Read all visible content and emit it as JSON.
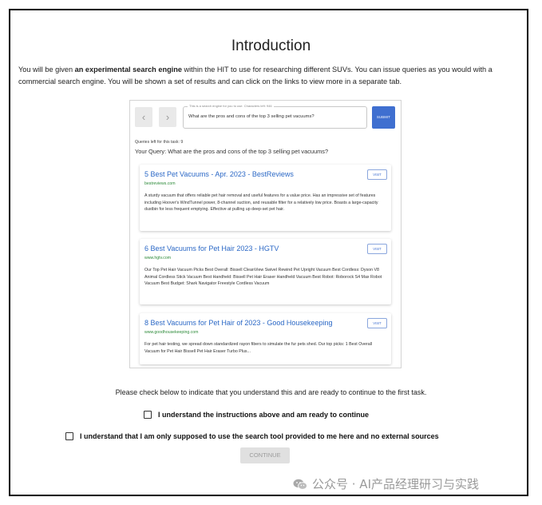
{
  "page": {
    "title": "Introduction",
    "intro_part1": "You will be given ",
    "intro_bold": "an experimental search engine",
    "intro_part2": " within the HIT to use for researching different SUVs. You can issue queries as you would with a commercial search engine. You will be shown a set of results and can click on the links to view more in a separate tab."
  },
  "search": {
    "back_icon": "chevron-left-icon",
    "forward_icon": "chevron-right-icon",
    "hint": "This is a search engine for you to use. Characters left: 946",
    "query_value": "What are the pros and cons of the top 3 selling pet vacuums?",
    "submit_label": "SUBMIT",
    "queries_left": "Queries left for this task: 9",
    "your_query": "Your Query: What are the pros and cons of the top 3 selling pet vacuums?"
  },
  "results": [
    {
      "title": "5 Best Pet Vacuums - Apr. 2023 - BestReviews",
      "url": "bestreviews.com",
      "visit_label": "VISIT",
      "snippet": "A sturdy vacuum that offers reliable pet hair removal and useful features for a value price. Has an impressive set of features including Hoover's WindTunnel power, 8-channel suction, and reusable filter for a relatively low price. Boasts a large-capacity dustbin for less frequent emptying. Effective at pulling up deep-set pet hair."
    },
    {
      "title": "6 Best Vacuums for Pet Hair 2023 - HGTV",
      "url": "www.hgtv.com",
      "visit_label": "VISIT",
      "snippet": "Our Top Pet Hair Vacuum Picks Best Overall: Bissell CleanView Swivel Rewind Pet Upright Vacuum Best Cordless: Dyson V8 Animal Cordless Stick Vacuum Best Handheld: Bissell Pet Hair Eraser Handheld Vacuum Best Robot: Roborock S4 Max Robot Vacuum Best Budget: Shark Navigator Freestyle Cordless Vacuum"
    },
    {
      "title": "8 Best Vacuums for Pet Hair of 2023 - Good Housekeeping",
      "url": "www.goodhousekeeping.com",
      "visit_label": "VISIT",
      "snippet": "For pet hair testing, we spread down standardized rayon fibers to simulate the fur pets shed. Our top picks: 1 Best Overall Vacuum for Pet Hair Bissell Pet Hair Eraser Turbo Plus..."
    }
  ],
  "footer": {
    "please_text": "Please check below to indicate that you understand this and are ready to continue to the first task.",
    "check1_label": "I understand the instructions above and am ready to continue",
    "check2_label": "I understand that I am only supposed to use the search tool provided to me here and no external sources",
    "continue_label": "CONTINUE"
  },
  "watermark": {
    "icon": "wechat-icon",
    "text": "公众号 · AI产品经理研习与实践"
  }
}
